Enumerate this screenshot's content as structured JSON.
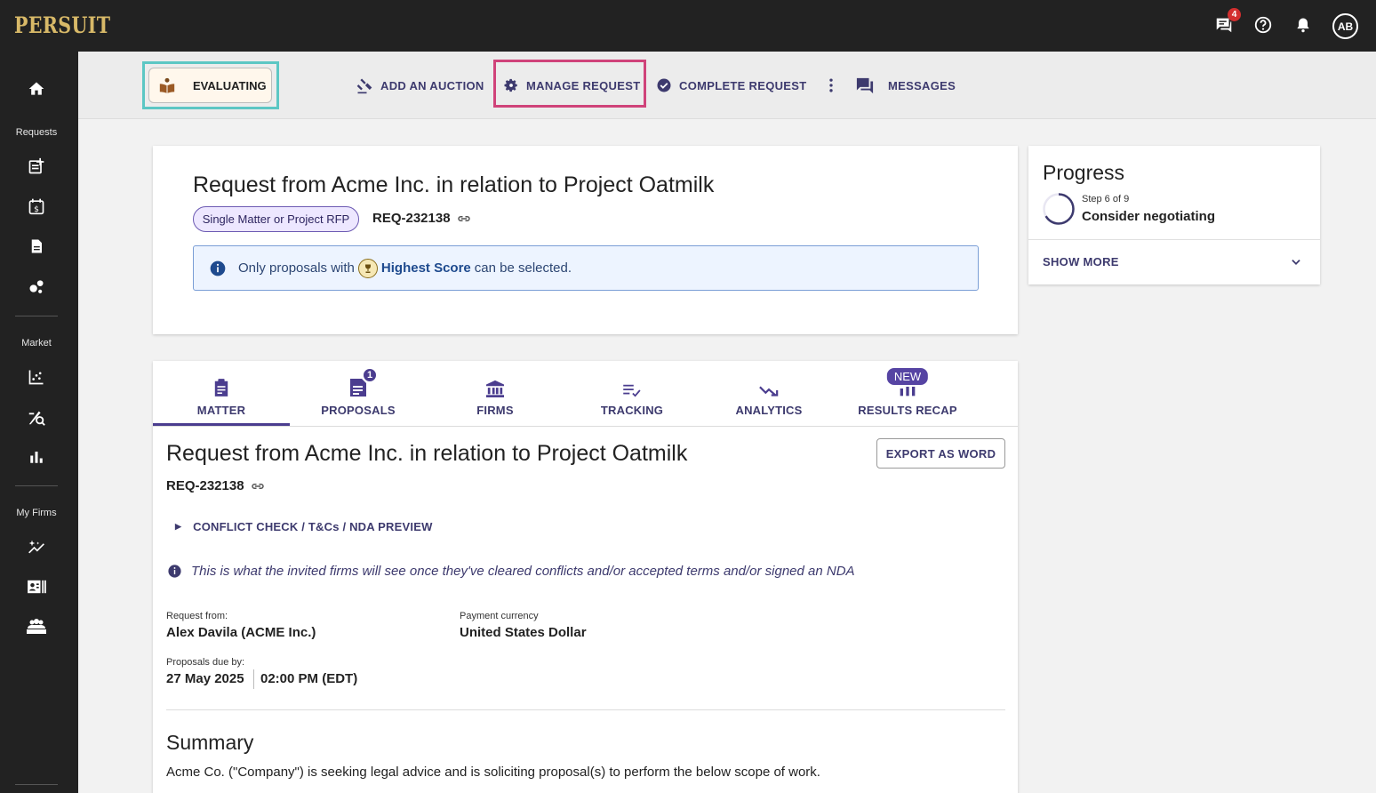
{
  "brand": {
    "logo_text": "PERSUIT",
    "logo_color": "#d8b968"
  },
  "topbar": {
    "messages_badge": "4",
    "avatar_initials": "AB",
    "icons": [
      "chat-icon",
      "help-icon",
      "bell-icon"
    ]
  },
  "sidebar": {
    "sections": [
      {
        "label": "Requests",
        "icons": [
          "edit-note-icon",
          "calendar-dollar-icon",
          "document-icon",
          "bubbles-icon"
        ]
      },
      {
        "label": "Market",
        "icons": [
          "scatter-chart-icon",
          "pen-search-icon",
          "bar-chart-icon"
        ]
      },
      {
        "label": "My Firms",
        "icons": [
          "sparkle-trend-icon",
          "contact-card-icon",
          "groups-icon"
        ]
      }
    ]
  },
  "actionbar": {
    "status_label": "EVALUATING",
    "actions": {
      "add_auction": "ADD AN AUCTION",
      "manage_request": "MANAGE REQUEST",
      "complete_request": "COMPLETE REQUEST",
      "messages": "MESSAGES"
    },
    "colors": {
      "teal_highlight": "#5cc7c4",
      "pink_highlight": "#d0437a"
    }
  },
  "request_header": {
    "title": "Request from Acme Inc. in relation to Project Oatmilk",
    "type_pill": "Single Matter or Project RFP",
    "request_id": "REQ-232138",
    "info": {
      "prefix": "Only proposals with",
      "highlight": "Highest Score",
      "suffix": "can be selected."
    }
  },
  "progress": {
    "title": "Progress",
    "step": "Step 6 of 9",
    "current": "Consider negotiating",
    "step_fraction": 0.667,
    "show_more": "SHOW MORE"
  },
  "tabs": [
    {
      "label": "MATTER",
      "icon": "clipboard-icon",
      "active": true
    },
    {
      "label": "PROPOSALS",
      "icon": "proposals-icon",
      "badge": "1"
    },
    {
      "label": "FIRMS",
      "icon": "bank-icon"
    },
    {
      "label": "TRACKING",
      "icon": "checklist-icon"
    },
    {
      "label": "ANALYTICS",
      "icon": "trend-down-icon"
    },
    {
      "label": "RESULTS RECAP",
      "icon": "results-icon",
      "badge": "NEW"
    }
  ],
  "matter": {
    "title": "Request from Acme Inc. in relation to Project Oatmilk",
    "request_id": "REQ-232138",
    "export_label": "EXPORT AS WORD",
    "conflict_link": "CONFLICT CHECK / T&Cs / NDA PREVIEW",
    "visibility_note": "This is what the invited firms will see once they've cleared conflicts and/or accepted terms and/or signed an NDA",
    "fields": {
      "request_from_label": "Request from:",
      "request_from_value": "Alex Davila (ACME Inc.)",
      "currency_label": "Payment currency",
      "currency_value": "United States Dollar",
      "due_label": "Proposals due by:",
      "due_date": "27 May 2025",
      "due_time": "02:00 PM (EDT)"
    },
    "summary_heading": "Summary",
    "summary_text": "Acme Co. (\"Company\") is seeking legal advice and is soliciting proposal(s) to perform the below scope of work."
  }
}
